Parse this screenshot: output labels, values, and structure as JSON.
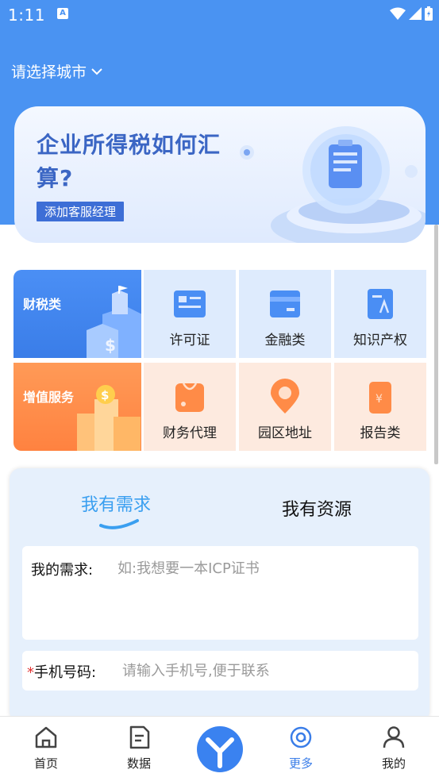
{
  "status_bar": {
    "time": "1:11"
  },
  "header": {
    "city_label": "请选择城市"
  },
  "banner": {
    "title": "企业所得税如何汇算?",
    "button_label": "添加客服经理"
  },
  "categories": {
    "primary": [
      {
        "label": "财税类",
        "color": "#4a8ef4"
      },
      {
        "label": "增值服务",
        "color": "#ff8b47"
      }
    ],
    "row1": [
      {
        "label": "许可证",
        "icon": "license-icon"
      },
      {
        "label": "金融类",
        "icon": "finance-icon"
      },
      {
        "label": "知识产权",
        "icon": "ip-icon"
      }
    ],
    "row2": [
      {
        "label": "财务代理",
        "icon": "bag-icon"
      },
      {
        "label": "园区地址",
        "icon": "location-icon"
      },
      {
        "label": "报告类",
        "icon": "report-icon"
      }
    ]
  },
  "request_form": {
    "tabs": [
      "我有需求",
      "我有资源"
    ],
    "active_tab": "我有需求",
    "need_label": "我的需求:",
    "need_placeholder": "如:我想要一本ICP证书",
    "phone_required_mark": "*",
    "phone_label": "手机号码:",
    "phone_placeholder": "请输入手机号,便于联系"
  },
  "bottom_nav": {
    "items": [
      {
        "label": "首页",
        "icon": "home-icon"
      },
      {
        "label": "数据",
        "icon": "document-icon"
      },
      {
        "label": "更多",
        "icon": "more-icon"
      },
      {
        "label": "我的",
        "icon": "user-icon"
      }
    ],
    "active": "更多"
  },
  "colors": {
    "primary": "#4a93f2",
    "accent_blue": "#3a9ff0",
    "orange": "#ff8b47"
  }
}
